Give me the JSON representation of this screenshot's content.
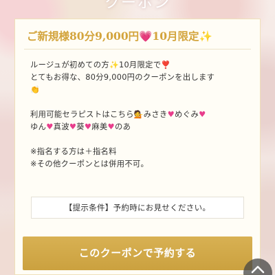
{
  "page": {
    "top_title": "クーポン"
  },
  "coupon": {
    "heading": "ご新規様80分9,000円💗10月限定✨",
    "intro_line1": "ルージュが初めての方",
    "intro_sparkle": "✨",
    "intro_line1b": "10月限定で",
    "intro_pin": "❣️",
    "intro_line2": "とてもお得な、80分9,000円のクーポンを出します",
    "intro_emoji": "👏",
    "therapists_label": "利用可能セラピストはこちら",
    "therapists_emoji": "💁",
    "therapists": [
      "みさき",
      "めぐみ",
      "ゆん",
      "真波",
      "葵",
      "麻美",
      "のあ"
    ],
    "note1": "※指名する方は＋指名料",
    "note2": "※その他クーポンとは併用不可。",
    "condition": "【提示条件】予約時にお見せください。",
    "cta_label": "このクーポンで予約する"
  },
  "colors": {
    "accent_gold": "#cba13f",
    "heading_gold": "#d3a43c",
    "heart_pink": "#e83e8c"
  },
  "icons": {
    "scroll_top": "chevron-up-icon"
  }
}
